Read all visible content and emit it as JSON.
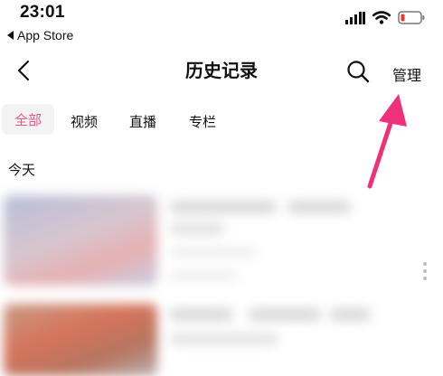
{
  "status_bar": {
    "time": "23:01",
    "back_app_label": "App Store"
  },
  "nav": {
    "title": "历史记录",
    "manage_label": "管理"
  },
  "tabs": [
    {
      "label": "全部",
      "active": true
    },
    {
      "label": "视频",
      "active": false
    },
    {
      "label": "直播",
      "active": false
    },
    {
      "label": "专栏",
      "active": false
    }
  ],
  "section": {
    "today_label": "今天"
  },
  "colors": {
    "accent_pink": "#e65a8a",
    "arrow_pink": "#f0307a",
    "battery_red": "#e53935"
  },
  "icons": {
    "back": "chevron-left-icon",
    "search": "search-icon",
    "more": "more-vertical-icon"
  }
}
